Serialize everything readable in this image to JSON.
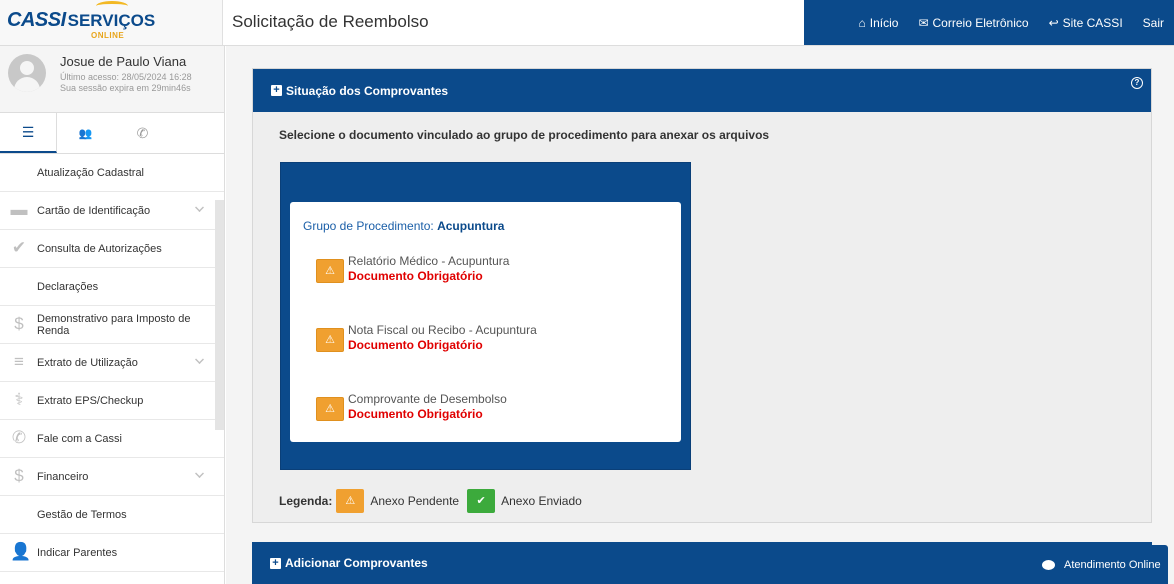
{
  "brand": {
    "logo_main": "CASSI",
    "logo_services": "SERVIÇOS",
    "logo_sub": "ONLINE",
    "accent": "#0b4a8b",
    "logo_arc": "#f2b824"
  },
  "header": {
    "title": "Solicitação de Reembolso",
    "nav": [
      {
        "label": "Início",
        "icon": "home-icon"
      },
      {
        "label": "Correio Eletrônico",
        "icon": "envelope-icon"
      },
      {
        "label": "Site CASSI",
        "icon": "reply-icon"
      },
      {
        "label": "Sair",
        "icon": ""
      }
    ]
  },
  "user": {
    "name": "Josue de Paulo Viana",
    "last_access": "Último acesso: 28/05/2024 16:28",
    "session": "Sua sessão expira em 29min46s"
  },
  "sidebar_tabs": [
    {
      "icon": "menu-icon",
      "glyph": "☰"
    },
    {
      "icon": "users-icon",
      "glyph": "👥"
    },
    {
      "icon": "phone-icon",
      "glyph": "✆"
    }
  ],
  "menu": [
    {
      "label": "Atualização Cadastral",
      "icon": "",
      "glyph": "",
      "chevron": false
    },
    {
      "label": "Cartão de Identificação",
      "icon": "card-icon",
      "glyph": "▬",
      "chevron": true
    },
    {
      "label": "Consulta de Autorizações",
      "icon": "check-icon",
      "glyph": "✔",
      "chevron": false
    },
    {
      "label": "Declarações",
      "icon": "",
      "glyph": "",
      "chevron": false
    },
    {
      "label": "Demonstrativo para Imposto de Renda",
      "icon": "dollar-icon",
      "glyph": "$",
      "chevron": false
    },
    {
      "label": "Extrato de Utilização",
      "icon": "list-icon",
      "glyph": "≡",
      "chevron": true
    },
    {
      "label": "Extrato EPS/Checkup",
      "icon": "stethoscope-icon",
      "glyph": "⚕",
      "chevron": false
    },
    {
      "label": "Fale com a Cassi",
      "icon": "phone-icon",
      "glyph": "✆",
      "chevron": false
    },
    {
      "label": "Financeiro",
      "icon": "dollar-icon",
      "glyph": "$",
      "chevron": true
    },
    {
      "label": "Gestão de Termos",
      "icon": "",
      "glyph": "",
      "chevron": false
    },
    {
      "label": "Indicar Parentes",
      "icon": "person-icon",
      "glyph": "👤",
      "chevron": false
    }
  ],
  "main": {
    "panel_title": "Situação dos Comprovantes",
    "instruction": "Selecione o documento vinculado ao grupo de procedimento para anexar os arquivos",
    "group_prefix": "Grupo de Procedimento:",
    "group_name": "Acupuntura",
    "documents": [
      {
        "name": "Relatório Médico - Acupuntura",
        "status": "Documento Obrigatório"
      },
      {
        "name": "Nota Fiscal ou Recibo - Acupuntura",
        "status": "Documento Obrigatório"
      },
      {
        "name": "Comprovante de Desembolso",
        "status": "Documento Obrigatório"
      }
    ],
    "legend_label": "Legenda:",
    "legend_pending": "Anexo Pendente",
    "legend_sent": "Anexo Enviado",
    "panel2_title": "Adicionar Comprovantes",
    "help_glyph": "?"
  },
  "chat": {
    "label": "Atendimento Online"
  },
  "colors": {
    "warning": "#f0a030",
    "success": "#3caa3c",
    "required": "#e00000"
  }
}
